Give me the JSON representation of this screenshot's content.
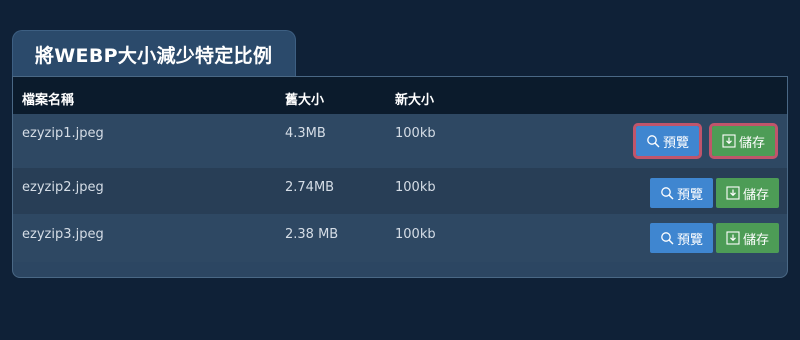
{
  "tab": {
    "title": "將WEBP大小減少特定比例"
  },
  "table": {
    "headers": {
      "filename": "檔案名稱",
      "old_size": "舊大小",
      "new_size": "新大小"
    },
    "rows": [
      {
        "filename": "ezyzip1.jpeg",
        "old_size": "4.3MB",
        "new_size": "100kb",
        "preview_label": "預覽",
        "save_label": "儲存"
      },
      {
        "filename": "ezyzip2.jpeg",
        "old_size": "2.74MB",
        "new_size": "100kb",
        "preview_label": "預覽",
        "save_label": "儲存"
      },
      {
        "filename": "ezyzip3.jpeg",
        "old_size": "2.38 MB",
        "new_size": "100kb",
        "preview_label": "預覽",
        "save_label": "儲存"
      }
    ]
  },
  "colors": {
    "preview_button": "#3f86d0",
    "save_button": "#4d9c56",
    "highlight": "#c0556b",
    "background": "#0f2137"
  },
  "icons": {
    "preview": "search-icon",
    "save": "download-icon"
  }
}
